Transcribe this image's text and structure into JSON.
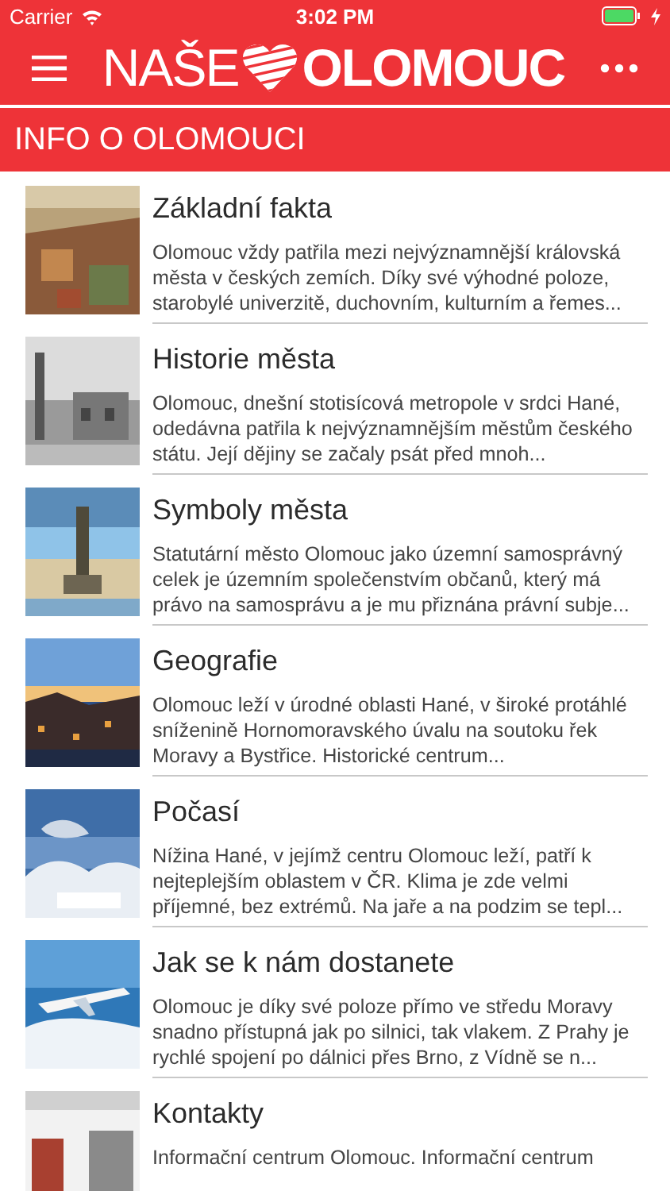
{
  "status_bar": {
    "carrier": "Carrier",
    "time": "3:02 PM",
    "charging": true
  },
  "nav": {
    "logo_left": "NAŠE",
    "logo_right": "OLOMOUC"
  },
  "section": {
    "title": "INFO O OLOMOUCI"
  },
  "items": [
    {
      "title": "Základní fakta",
      "text": "Olomouc vždy patřila mezi nejvýznamnější královská města v českých zemích. Díky své výhodné poloze, starobylé univerzitě, duchovním, kulturním a řemes...",
      "kind": "city"
    },
    {
      "title": "Historie města",
      "text": "Olomouc, dnešní stotisícová metropole v srdci Hané, odedávna patřila k nejvýznamnějším městům českého státu. Její dějiny se začaly psát před mnoh...",
      "kind": "old"
    },
    {
      "title": "Symboly města",
      "text": "Statutární město Olomouc jako územní samosprávný celek je územním společenstvím občanů, který má právo na samosprávu a je mu přiznána právní subje...",
      "kind": "column"
    },
    {
      "title": "Geografie",
      "text": "Olomouc leží v úrodné oblasti Hané, v široké protáhlé sníženině Hornomoravského úvalu na soutoku řek Moravy a Bystřice. Historické centrum...",
      "kind": "night"
    },
    {
      "title": "Počasí",
      "text": "Nížina Hané, v jejímž centru Olomouc leží, patří k nejteplejším oblastem v ČR. Klima je zde velmi příjemné, bez extrémů.  Na jaře a na podzim se tepl...",
      "kind": "clouds"
    },
    {
      "title": "Jak se k nám dostanete",
      "text": "Olomouc je díky své poloze přímo ve středu Moravy snadno přístupná jak po silnici, tak vlakem. Z Prahy je rychlé spojení po dálnici přes Brno, z Vídně se n...",
      "kind": "plane"
    },
    {
      "title": "Kontakty",
      "text": "Informační centrum Olomouc. Informační centrum",
      "kind": "office"
    }
  ]
}
